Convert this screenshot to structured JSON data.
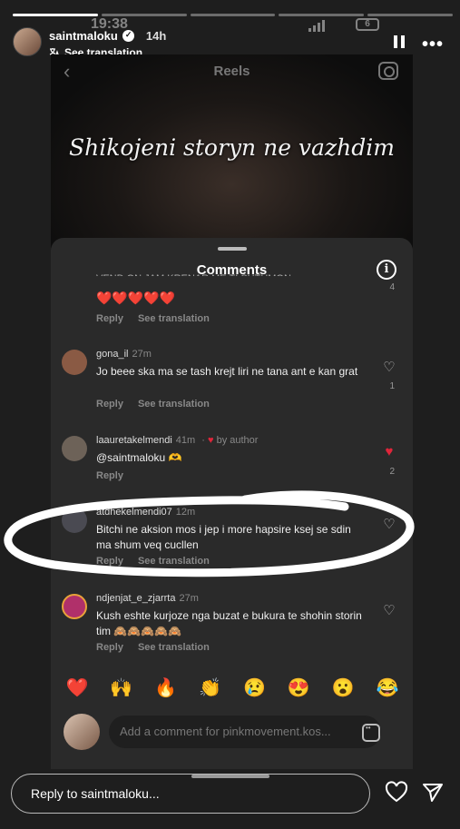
{
  "status": {
    "time": "19:38",
    "battery": "6"
  },
  "story": {
    "username": "saintmaloku",
    "time_ago": "14h",
    "see_translation": "See translation",
    "progress_total": 5,
    "progress_done": 1
  },
  "reel": {
    "header": "Reels",
    "overlay_text": "Shikojeni storyn ne vazhdim"
  },
  "comments_sheet": {
    "title": "Comments",
    "partial_top": {
      "body_cut": "VEND ON JAM KRENAR ME TI SHTHMON",
      "hearts": "❤️❤️❤️❤️❤️",
      "reply": "Reply",
      "see_translation": "See translation",
      "count": "4"
    },
    "comments": [
      {
        "user": "gona_il",
        "time": "27m",
        "body": "Jo beee ska ma se tash krejt liri ne tana ant e kan grat",
        "reply": "Reply",
        "see_translation": "See translation",
        "likes": "1",
        "liked": false,
        "avatar_color": "#8a5a44"
      },
      {
        "user": "laauretakelmendi",
        "time": "41m",
        "author_tag": "by author",
        "body": "@saintmaloku 🫶",
        "reply": "Reply",
        "likes": "2",
        "liked": true,
        "avatar_color": "#6d6258"
      },
      {
        "user": "atdhekelmendi07",
        "time": "12m",
        "body": "Bitchi ne aksion mos i jep i more hapsire ksej se sdin ma shum veq cucllen",
        "reply": "Reply",
        "see_translation": "See translation",
        "likes": "",
        "liked": false,
        "avatar_color": "#4a4a52"
      },
      {
        "user": "ndjenjat_e_zjarrta",
        "time": "27m",
        "body": "Kush eshte kurjoze nga buzat e bukura te shohin storin tim 🙈🙈🙈🙈🙈",
        "reply": "Reply",
        "see_translation": "See translation",
        "likes": "",
        "liked": false,
        "avatar_color": "#b0306a"
      }
    ],
    "emojis": [
      "❤️",
      "🙌",
      "🔥",
      "👏",
      "😢",
      "😍",
      "😮",
      "😂"
    ],
    "add_comment_placeholder": "Add a comment for pinkmovement.kos..."
  },
  "footer": {
    "reply_placeholder": "Reply to saintmaloku..."
  },
  "colors": {
    "like_red": "#e0253a",
    "sheet_bg": "#2a2a2a",
    "page_bg": "#1e1e1e"
  },
  "icons": {
    "pause": "pause-icon",
    "more": "more-icon",
    "info": "info-icon",
    "heart": "heart-icon",
    "send": "send-icon",
    "gif": "gif-sticker-icon"
  }
}
